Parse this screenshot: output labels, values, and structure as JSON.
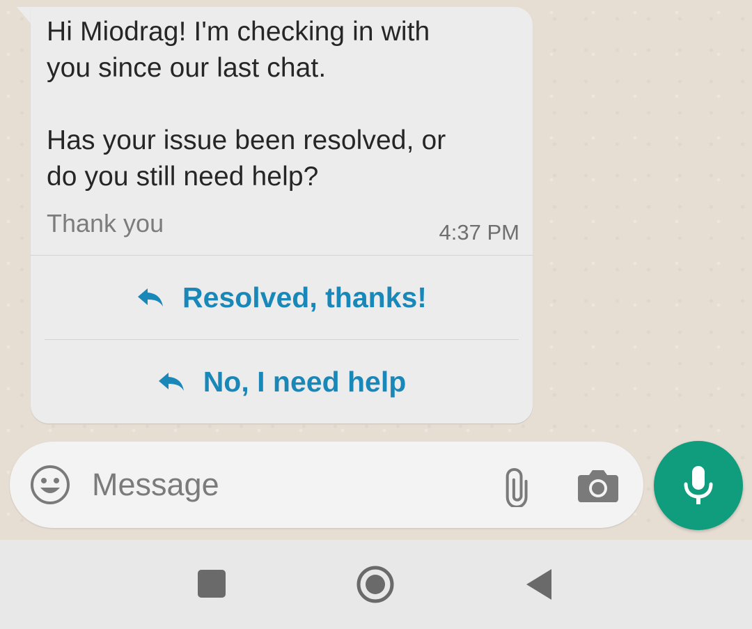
{
  "message": {
    "body": "Hi Miodrag! I'm checking in with\nyou since our last chat.\n\nHas your issue been resolved, or\ndo you still need help?",
    "footer": "Thank you",
    "time": "4:37 PM",
    "quick_replies": [
      {
        "label": "Resolved, thanks!",
        "icon": "reply-icon"
      },
      {
        "label": "No, I need help",
        "icon": "reply-icon"
      }
    ]
  },
  "composer": {
    "placeholder": "Message",
    "icons": [
      "emoji-icon",
      "paperclip-icon",
      "camera-icon"
    ],
    "send_icon": "microphone-icon"
  },
  "navigation": {
    "icons": [
      "recents-square-icon",
      "home-circle-icon",
      "back-triangle-icon"
    ]
  },
  "colors": {
    "bubble": "#ececec",
    "accent_link": "#1a87b9",
    "mic_button": "#0f9d7d",
    "wallpaper": "#e6ddd3"
  }
}
